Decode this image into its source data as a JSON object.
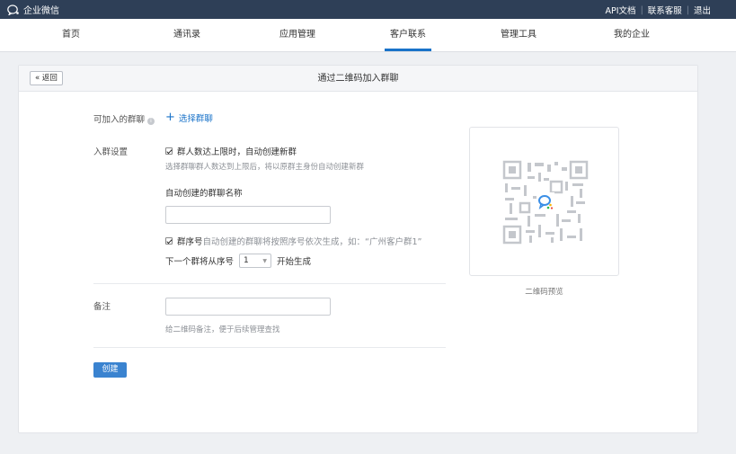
{
  "topbar": {
    "brand": "企业微信",
    "links": [
      "API文档",
      "联系客服",
      "退出"
    ]
  },
  "nav": {
    "items": [
      "首页",
      "通讯录",
      "应用管理",
      "客户联系",
      "管理工具",
      "我的企业"
    ],
    "active_index": 3
  },
  "card": {
    "back_label": "« 返回",
    "title": "通过二维码加入群聊"
  },
  "form": {
    "joinable_label": "可加入的群聊",
    "select_group_label": "选择群聊",
    "group_settings_label": "入群设置",
    "auto_create_checkbox": "群人数达上限时，自动创建新群",
    "auto_create_hint": "选择群聊群人数达到上限后，将以原群主身份自动创建新群",
    "auto_name_label": "自动创建的群聊名称",
    "auto_name_value": "",
    "seq_checkbox_strong": "群序号",
    "seq_checkbox_desc": "自动创建的群聊将按照序号依次生成，如：“广州客户群1”",
    "seq_prefix": "下一个群将从序号",
    "seq_value": "1",
    "seq_suffix": "开始生成",
    "remark_label": "备注",
    "remark_value": "",
    "remark_hint": "给二维码备注，便于后续管理查找",
    "create_button": "创建"
  },
  "preview": {
    "caption": "二维码预览"
  },
  "colors": {
    "topbar": "#2e3f57",
    "accent": "#1a73c9",
    "button": "#3a83d0"
  }
}
